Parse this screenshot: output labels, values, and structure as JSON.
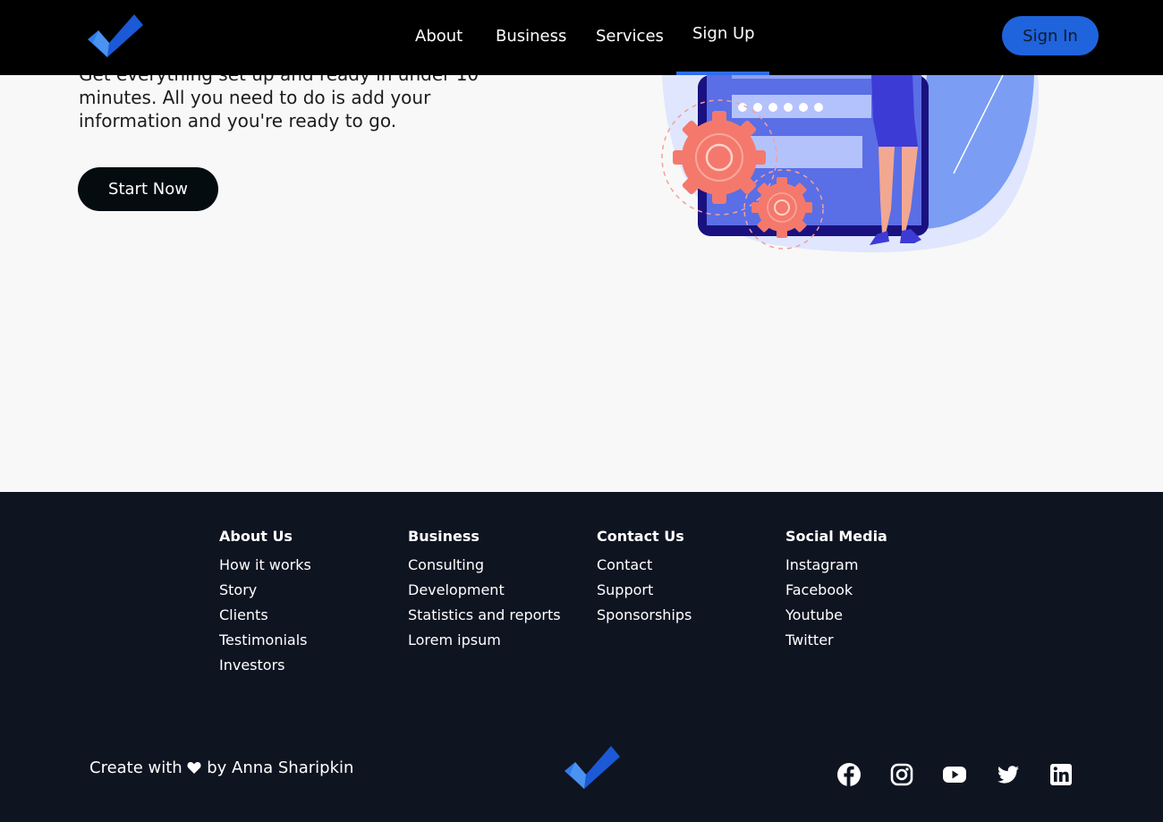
{
  "nav": {
    "links": [
      "About",
      "Business",
      "Services"
    ],
    "active_link": "Sign Up",
    "signin_label": "Sign In",
    "accent": "#2f6ee8"
  },
  "hero": {
    "description": "Get everything set up and ready in under 10 minutes. All you need to do is add your information and you're ready to go.",
    "cta_label": "Start Now"
  },
  "footer": {
    "columns": [
      {
        "title": "About Us",
        "items": [
          "How it works",
          "Story",
          "Clients",
          "Testimonials",
          "Investors"
        ]
      },
      {
        "title": "Business",
        "items": [
          "Consulting",
          "Development",
          "Statistics and reports",
          "Lorem ipsum"
        ]
      },
      {
        "title": "Contact Us",
        "items": [
          "Contact",
          "Support",
          "Sponsorships"
        ]
      },
      {
        "title": "Social Media",
        "items": [
          "Instagram",
          "Facebook",
          "Youtube",
          "Twitter"
        ]
      }
    ],
    "credit_prefix": "Create with",
    "credit_suffix": "by Anna Sharipkin",
    "social_icons": [
      "facebook-icon",
      "instagram-icon",
      "youtube-icon",
      "twitter-icon",
      "linkedin-icon"
    ]
  },
  "colors": {
    "nav_bg": "#000000",
    "footer_bg": "#0f1421",
    "signin_bg": "#1f64dc",
    "cta_bg": "#050c10"
  }
}
